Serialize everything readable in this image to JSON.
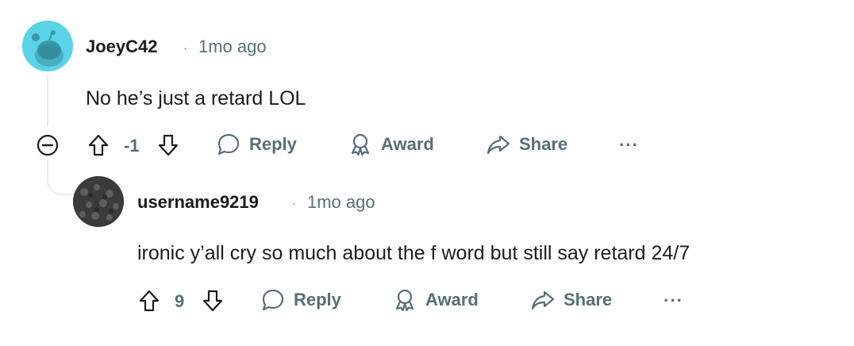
{
  "comments": [
    {
      "username": "JoeyC42",
      "separator": "·",
      "time": "1mo ago",
      "body": "No he’s just a retard LOL",
      "score": "-1",
      "actions": {
        "reply": "Reply",
        "award": "Award",
        "share": "Share",
        "more": "···"
      },
      "avatar_color": "#5ad2e8"
    },
    {
      "username": "username9219",
      "separator": "·",
      "time": "1mo ago",
      "body": "ironic y’all cry so much about the f word but still say retard 24/7",
      "score": "9",
      "actions": {
        "reply": "Reply",
        "award": "Award",
        "share": "Share",
        "more": "···"
      },
      "avatar_color": "#3a3a3a"
    }
  ],
  "colors": {
    "meta": "#576f76",
    "text": "#1c1c1c",
    "line": "#e5ebee"
  },
  "icons": [
    "upvote-icon",
    "downvote-icon",
    "reply-icon",
    "award-icon",
    "share-icon",
    "collapse-icon"
  ]
}
